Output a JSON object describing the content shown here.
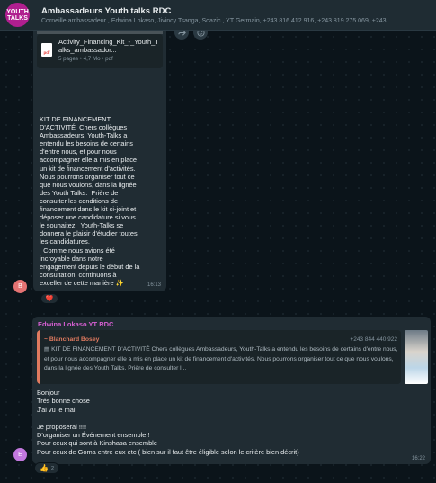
{
  "header": {
    "avatar_text": "YOUTH TALKS",
    "group_name": "Ambassadeurs Youth talks RDC",
    "participants": "Corneille ambassadeur , Edwina Lokaso, Jivincy Tsanga, Soazic , YT Germain, +243 816 412 916, +243 819 275 069, +243"
  },
  "message1": {
    "document": {
      "file_name": "Activity_Financing_Kit_-_Youth_Talks_ambassador...",
      "meta": "5 pages • 4,7 Mo • pdf",
      "icon_label": "pdf"
    },
    "text": "KIT DE FINANCEMENT\nD'ACTIVITÉ  Chers collègues\nAmbassadeurs, Youth-Talks a\nentendu les besoins de certains\nd'entre nous, et pour nous\naccompagner elle a mis en place\nun kit de financement d'activités.\nNous pourrons organiser tout ce\nque nous voulons, dans la lignée\ndes Youth Talks.  Prière de\nconsulter les conditions de\nfinancement dans le kit ci-joint et\ndéposer une candidature si vous\nle souhaitez.  Youth-Talks se\ndonnera le plaisir d'étudier toutes\nles candidatures.\n  Comme nous avions été\nincroyable dans notre\nengagement depuis le début de la\nconsultation, continuons à\nexceller de cette manière ✨",
    "time": "16:13",
    "avatar_letter": "B",
    "reaction": "❤️"
  },
  "message2": {
    "sender": "Edwina Lokaso YT RDC",
    "quote": {
      "name": "~ Blanchard Bosey",
      "phone": "+243 844 440 922",
      "text": "▤ KIT DE FINANCEMENT D'ACTIVITÉ  Chers collègues Ambassadeurs, Youth-Talks a entendu les besoins de certains d'entre nous, et pour nous accompagner elle a mis en place un kit de financement d'activités. Nous pourrons organiser tout ce que nous voulons, dans la lignée des Youth Talks.  Prière de consulter l..."
    },
    "text": "Bonjour\nTrès bonne chose\nJ'ai vu le mail\n\nJe proposerai !!!!\nD'organiser un Événement ensemble !\nPour ceux qui sont à Kinshasa ensemble\nPour ceux de Goma entre eux etc ( bien sur il faut être éligible selon le critère bien décrit)",
    "time": "16:22",
    "avatar_letter": "E",
    "reaction": "👍",
    "reaction_count": "2"
  },
  "colors": {
    "background": "#0b141a",
    "bubble": "#202c33",
    "sender_name": "#d55fd2",
    "quote_accent": "#e07a5f"
  }
}
